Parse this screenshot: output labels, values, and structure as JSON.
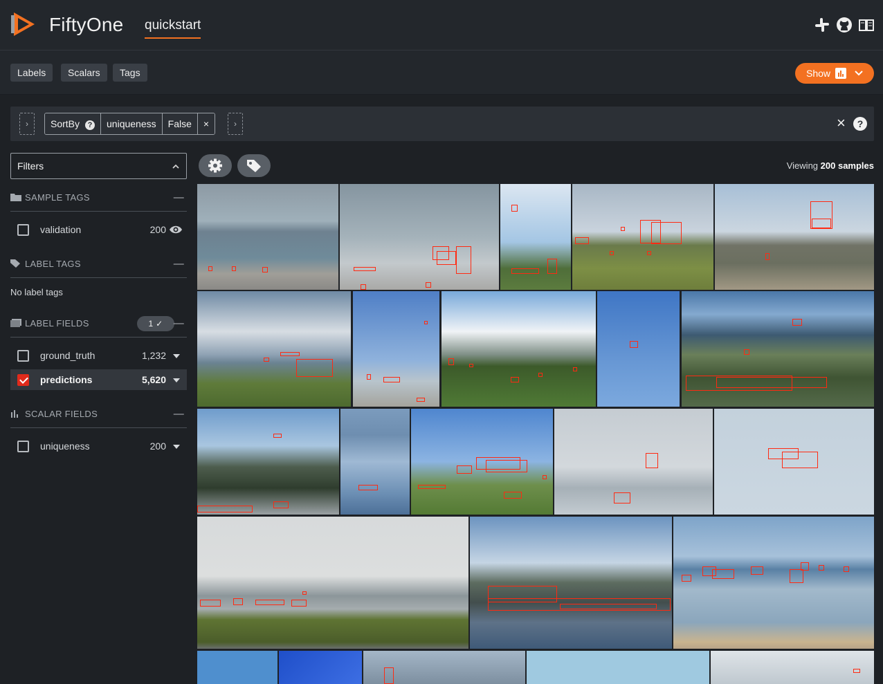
{
  "app": {
    "name": "FiftyOne",
    "dataset": "quickstart",
    "header_icons": [
      "slack-icon",
      "github-icon",
      "book-icon"
    ]
  },
  "tabs": [
    "Labels",
    "Scalars",
    "Tags"
  ],
  "show_button": {
    "label": "Show",
    "icon": "bar-chart-icon",
    "color": "#f37121"
  },
  "view_bar": {
    "stage_name": "SortBy",
    "stage_help": "?",
    "params": [
      "uniqueness",
      "False"
    ],
    "remove": "×",
    "expand_left": "›",
    "expand_right": "›",
    "close": "×",
    "help": "?"
  },
  "sidebar": {
    "filters_label": "Filters",
    "sections": {
      "sample_tags": {
        "title": "SAMPLE TAGS",
        "items": [
          {
            "label": "validation",
            "count": "200",
            "checked": false
          }
        ]
      },
      "label_tags": {
        "title": "LABEL TAGS",
        "empty": "No label tags"
      },
      "label_fields": {
        "title": "LABEL FIELDS",
        "badge": "1 ✓",
        "items": [
          {
            "label": "ground_truth",
            "count": "1,232",
            "checked": false
          },
          {
            "label": "predictions",
            "count": "5,620",
            "checked": true
          }
        ]
      },
      "scalar_fields": {
        "title": "SCALAR FIELDS",
        "items": [
          {
            "label": "uniqueness",
            "count": "200",
            "checked": false
          }
        ]
      }
    }
  },
  "grid": {
    "viewing_prefix": "Viewing",
    "viewing_count": "200 samples",
    "toolbar_icons": [
      "settings-icon",
      "tag-icon"
    ],
    "box_color": "#ff2a12"
  }
}
